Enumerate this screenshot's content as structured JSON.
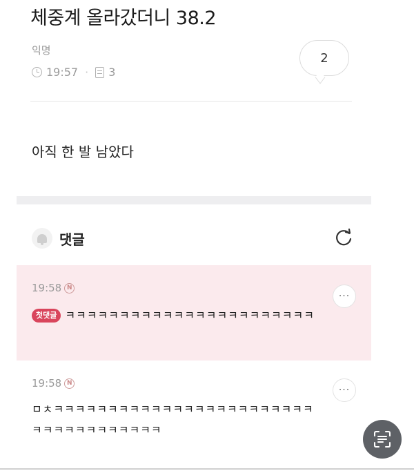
{
  "post": {
    "title": "체중계 올라갔더니 38.2",
    "author": "익명",
    "time": "19:57",
    "views": "3",
    "comment_count": "2",
    "body": "아직 한 발 남았다"
  },
  "comments_section": {
    "label": "댓글"
  },
  "comments": [
    {
      "time": "19:58",
      "new_badge": "N",
      "first_badge": "첫댓글",
      "text": "ㅋㅋㅋㅋㅋㅋㅋㅋㅋㅋㅋㅋㅋㅋㅋㅋㅋㅋㅋㅋㅋㅋㅋ"
    },
    {
      "time": "19:58",
      "new_badge": "N",
      "text": "ㅁㅊㅋㅋㅋㅋㅋㅋㅋㅋㅋㅋㅋㅋㅋㅋㅋㅋㅋㅋㅋㅋㅋㅋㅋㅋㅋㅋㅋㅋㅋㅋㅋㅋㅋㅋㅋㅋ"
    }
  ],
  "colors": {
    "first_comment_bg": "#fbeaed",
    "first_badge": "#d9455c",
    "scan_button": "#5e6166"
  },
  "icons": {
    "time": "clock-icon",
    "views": "document-icon",
    "bell": "bell-icon",
    "refresh": "refresh-icon",
    "more": "more-icon",
    "scan": "scan-text-icon"
  }
}
